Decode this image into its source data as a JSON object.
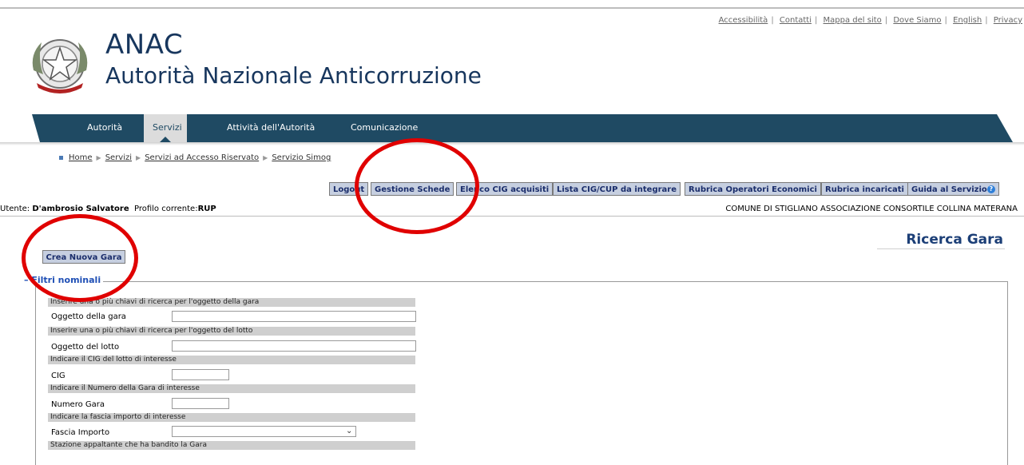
{
  "utility_links": [
    "Accessibilità",
    "Contatti",
    "Mappa del sito",
    "Dove Siamo",
    "English",
    "Privacy"
  ],
  "logo": {
    "abbr": "ANAC",
    "full": "Autorità Nazionale Anticorruzione",
    "emblem_icon": "italian-republic-emblem-icon"
  },
  "nav": {
    "items": [
      "Autorità",
      "Servizi",
      "Attività dell'Autorità",
      "Comunicazione"
    ],
    "active": "Servizi",
    "color": "#1f4a63"
  },
  "breadcrumb": [
    "Home",
    "Servizi",
    "Servizi ad Accesso Riservato",
    "Servizio Simog"
  ],
  "toolbar": {
    "logout": "Logout",
    "gestione": "Gestione Schede",
    "elenco": "Elenco CIG acquisiti",
    "lista": "Lista CIG/CUP da integrare",
    "rubrica_op": "Rubrica Operatori Economici",
    "rubrica_inc": "Rubrica incaricati",
    "guida": "Guida al Servizio"
  },
  "user": {
    "user_label": "Utente:",
    "user_name": "D'ambrosio Salvatore",
    "profile_label": "Profilo corrente:",
    "profile_value": "RUP",
    "org": "COMUNE DI STIGLIANO  ASSOCIAZIONE CONSORTILE COLLINA MATERANA"
  },
  "page": {
    "title": "Ricerca Gara",
    "create_button": "Crea Nuova Gara"
  },
  "filters": {
    "legend": "Filtri nominali",
    "h_oggetto_gara": "Inserire una o più chiavi di ricerca per l'oggetto della gara",
    "l_oggetto_gara": "Oggetto della gara",
    "v_oggetto_gara": "",
    "h_oggetto_lotto": "Inserire una o più chiavi di ricerca per l'oggetto del lotto",
    "l_oggetto_lotto": "Oggetto del lotto",
    "v_oggetto_lotto": "",
    "h_cig": "Indicare il CIG del lotto di interesse",
    "l_cig": "CIG",
    "v_cig": "",
    "h_numero": "Indicare il Numero della Gara di interesse",
    "l_numero": "Numero Gara",
    "v_numero": "",
    "h_fascia": "Indicare la fascia importo di interesse",
    "l_fascia": "Fascia Importo",
    "v_fascia": "",
    "h_stazione": "Stazione appaltante che ha bandito la Gara"
  },
  "annotation_color": "#e00000"
}
